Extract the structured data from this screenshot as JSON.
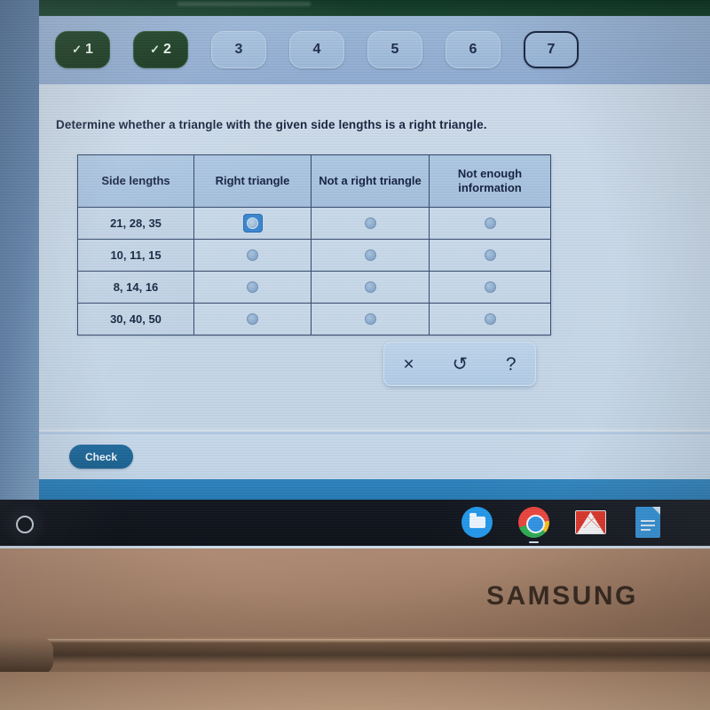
{
  "browser": {
    "topbar_color": "#143a28"
  },
  "progress": {
    "steps": [
      {
        "label": "1",
        "state": "completed",
        "icon": "check-icon"
      },
      {
        "label": "2",
        "state": "completed",
        "icon": "check-icon"
      },
      {
        "label": "3",
        "state": "pending",
        "icon": ""
      },
      {
        "label": "4",
        "state": "pending",
        "icon": ""
      },
      {
        "label": "5",
        "state": "pending",
        "icon": ""
      },
      {
        "label": "6",
        "state": "pending",
        "icon": ""
      },
      {
        "label": "7",
        "state": "current",
        "icon": ""
      }
    ],
    "completed_color": "#1d4226",
    "pending_color": "#9cb8d8"
  },
  "question": {
    "prompt": "Determine whether a triangle with the given side lengths is a right triangle."
  },
  "table": {
    "headers": [
      "Side lengths",
      "Right triangle",
      "Not a right triangle",
      "Not enough information"
    ],
    "rows": [
      {
        "side_lengths": "21, 28, 35",
        "selected": null,
        "focused_column": 1
      },
      {
        "side_lengths": "10, 11, 15",
        "selected": null,
        "focused_column": null
      },
      {
        "side_lengths": "8, 14, 16",
        "selected": null,
        "focused_column": null
      },
      {
        "side_lengths": "30, 40, 50",
        "selected": null,
        "focused_column": null
      }
    ]
  },
  "toolbar": {
    "tools": [
      {
        "name": "clear",
        "glyph": "×"
      },
      {
        "name": "undo",
        "glyph": "↺"
      },
      {
        "name": "help",
        "glyph": "?"
      }
    ]
  },
  "footer": {
    "check_label": "Check",
    "check_color": "#1f6a9e"
  },
  "shelf": {
    "launcher_label": "",
    "apps": [
      {
        "name": "files",
        "label": "Files"
      },
      {
        "name": "chrome",
        "label": "Chrome"
      },
      {
        "name": "gmail",
        "label": "Gmail"
      },
      {
        "name": "docs",
        "label": "Docs"
      }
    ]
  },
  "device": {
    "brand": "SAMSUNG"
  }
}
